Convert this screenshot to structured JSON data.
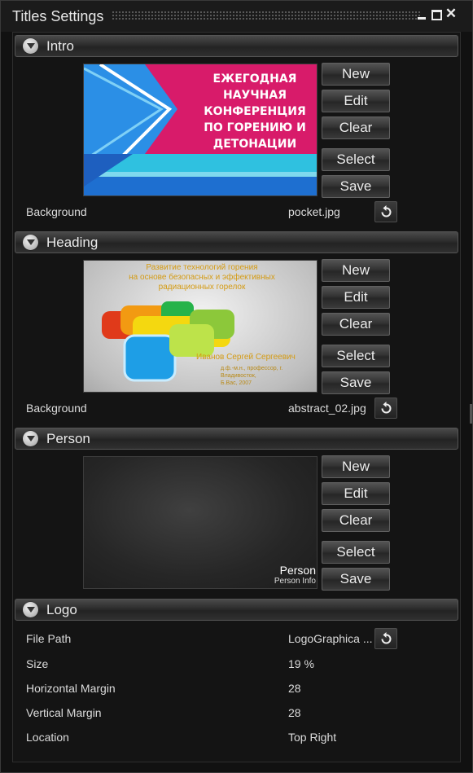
{
  "window": {
    "title": "Titles Settings",
    "controls": [
      "minimize-icon",
      "maximize-icon",
      "close-icon"
    ],
    "close_glyph": "✕"
  },
  "intro": {
    "title": "Intro",
    "thumbnail_text": "ЕЖЕГОДНАЯ\nНАУЧНАЯ\nКОНФЕРЕНЦИЯ\nПО ГОРЕНИЮ И\nДЕТОНАЦИИ",
    "buttons": {
      "new": "New",
      "edit": "Edit",
      "clear": "Clear",
      "select": "Select",
      "save": "Save"
    },
    "property_label": "Background",
    "property_value": "pocket.jpg"
  },
  "heading": {
    "title": "Heading",
    "thumbnail_text": "Развитие технологий горения\nна основе безопасных и эффективных\nрадиационных горелок",
    "thumbnail_name": "Иванов Сергей Сергеевич",
    "thumbnail_sub": "д.ф.-м.н., профессор, г. Владивосток,\nБ.Вас, 2007",
    "buttons": {
      "new": "New",
      "edit": "Edit",
      "clear": "Clear",
      "select": "Select",
      "save": "Save"
    },
    "property_label": "Background",
    "property_value": "abstract_02.jpg"
  },
  "person": {
    "title": "Person",
    "thumbnail_name": "Person",
    "thumbnail_info": "Person Info",
    "buttons": {
      "new": "New",
      "edit": "Edit",
      "clear": "Clear",
      "select": "Select",
      "save": "Save"
    }
  },
  "logo": {
    "title": "Logo",
    "properties": [
      {
        "label": "File Path",
        "value": "LogoGraphica ..."
      },
      {
        "label": "Size",
        "value": "19 %"
      },
      {
        "label": "Horizontal Margin",
        "value": "28"
      },
      {
        "label": "Vertical Margin",
        "value": "28"
      },
      {
        "label": "Location",
        "value": "Top Right"
      }
    ]
  },
  "colors": {
    "background": "#111111",
    "intro_pink": "#d81b6a",
    "intro_blue": "#1e7fd8",
    "intro_cyan": "#2fc1e0",
    "heading_gold": "#d49b14"
  }
}
